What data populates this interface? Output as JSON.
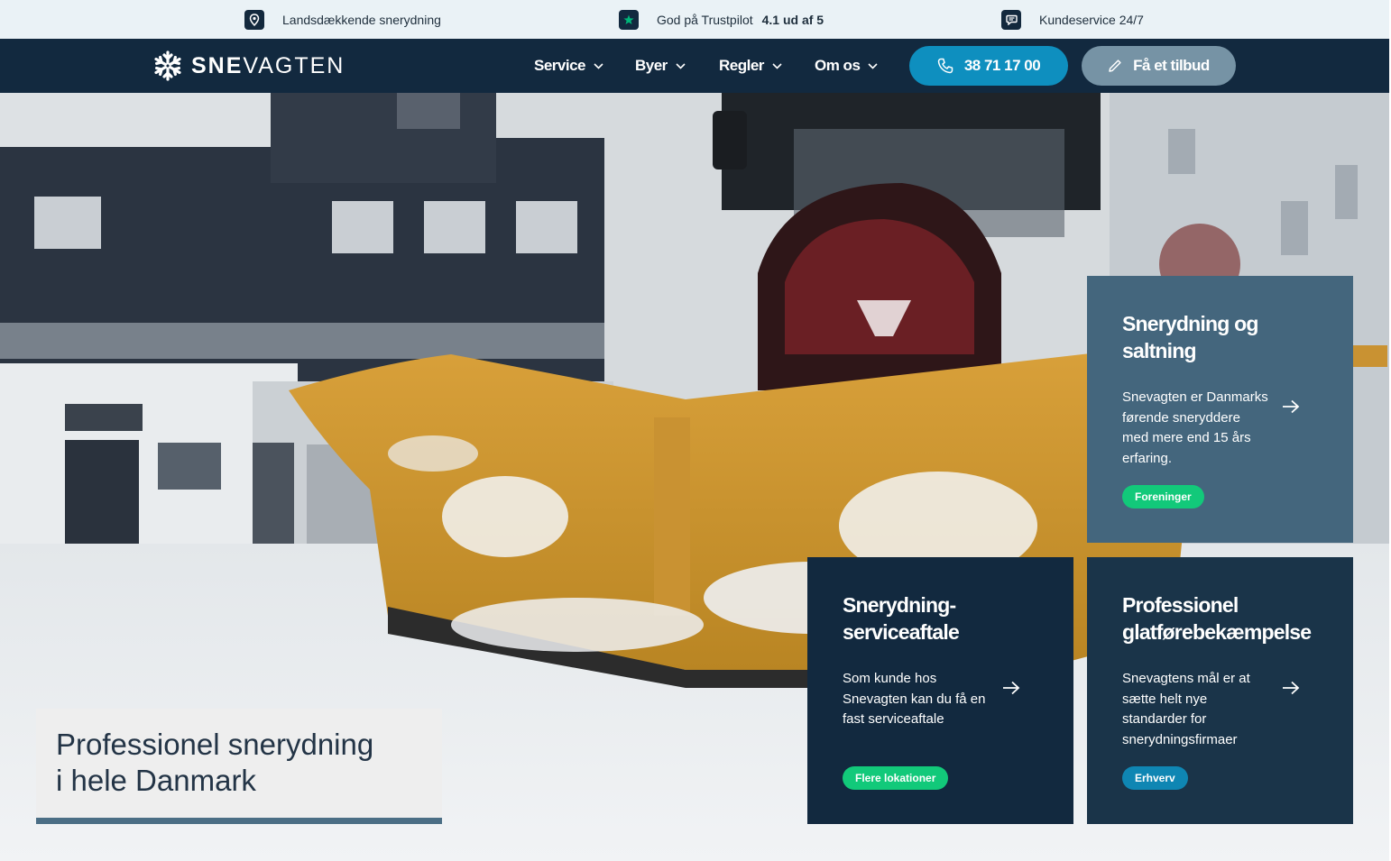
{
  "topbar": {
    "items": [
      {
        "icon": "location-pin-icon",
        "text": "Landsdækkende snerydning"
      },
      {
        "icon": "trustpilot-star-icon",
        "text": "God på Trustpilot",
        "bold": "4.1 ud af 5"
      },
      {
        "icon": "chat-bubble-icon",
        "text": "Kundeservice 24/7"
      }
    ]
  },
  "header": {
    "logo": {
      "icon": "snowflake-icon",
      "bold": "SNE",
      "rest": "VAGTEN"
    },
    "nav": [
      {
        "label": "Service",
        "icon": "chevron-down-icon"
      },
      {
        "label": "Byer",
        "icon": "chevron-down-icon"
      },
      {
        "label": "Regler",
        "icon": "chevron-down-icon"
      },
      {
        "label": "Om os",
        "icon": "chevron-down-icon"
      }
    ],
    "phone_button": {
      "icon": "phone-icon",
      "label": "38 71 17 00"
    },
    "quote_button": {
      "icon": "pencil-icon",
      "label": "Få et tilbud"
    }
  },
  "hero": {
    "headline": [
      "Professionel snerydning",
      "i hele Danmark"
    ],
    "cards": [
      {
        "title": [
          "Snerydning og",
          "saltning"
        ],
        "body": "Snevagten er Danmarks førende sneryddere med mere end 15 års erfaring.",
        "tag": "Foreninger",
        "arrow_icon": "arrow-right-icon"
      },
      {
        "title": [
          "Snerydning-",
          "serviceaftale"
        ],
        "body": "Som kunde hos Snevagten kan du få en fast serviceaftale",
        "tag": "Flere lokationer",
        "arrow_icon": "arrow-right-icon"
      },
      {
        "title": [
          "Professionel",
          "glatførebekæmpelse"
        ],
        "body": "Snevagtens mål er at sætte helt nye standarder for snerydningsfirmaer",
        "tag": "Erhverv",
        "arrow_icon": "arrow-right-icon"
      }
    ]
  },
  "colors": {
    "navy": "#12293f",
    "card_light": "#44667d",
    "phone_button": "#0e8fbf",
    "quote_button": "#7693a5",
    "tag_green": "#12c97a",
    "tag_blue": "#0f86b3",
    "topbar_bg": "#eaf2f6"
  }
}
